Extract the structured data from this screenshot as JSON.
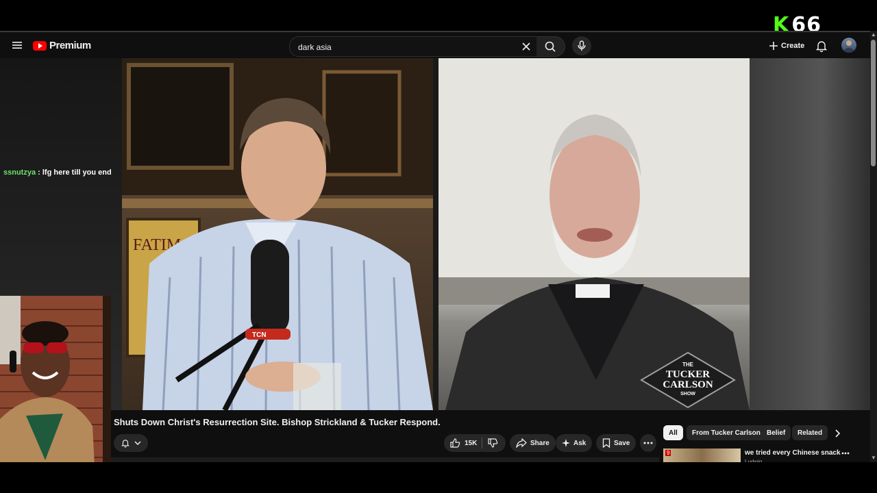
{
  "stream_overlay": {
    "logo_letter": "K",
    "logo_number": "66"
  },
  "app": {
    "brand": "Premium"
  },
  "search": {
    "value": "dark asia",
    "placeholder": "Search"
  },
  "header": {
    "create_label": "Create"
  },
  "chat": {
    "username": "ssnutzya",
    "separator": " : ",
    "message": "lfg here till you end"
  },
  "video": {
    "title": "Shuts Down Christ's Resurrection Site. Bishop Strickland & Tucker Respond.",
    "mic_label": "TCN",
    "left_poster_text": "FATIMA",
    "watermark": {
      "line1": "THE",
      "line2": "TUCKER",
      "line3": "CARLSON",
      "line4": "SHOW"
    }
  },
  "actions": {
    "likes": "15K",
    "share": "Share",
    "ask": "Ask",
    "save": "Save"
  },
  "chips": [
    "All",
    "From Tucker Carlson",
    "Belief",
    "Related"
  ],
  "recommendation": {
    "title": "we tried every Chinese snack",
    "channel": "Ludwig",
    "badge": "9"
  },
  "colors": {
    "accent_red": "#ff0000",
    "kick_green": "#53fc18",
    "chat_user": "#6de26d",
    "background": "#0f0f0f"
  }
}
